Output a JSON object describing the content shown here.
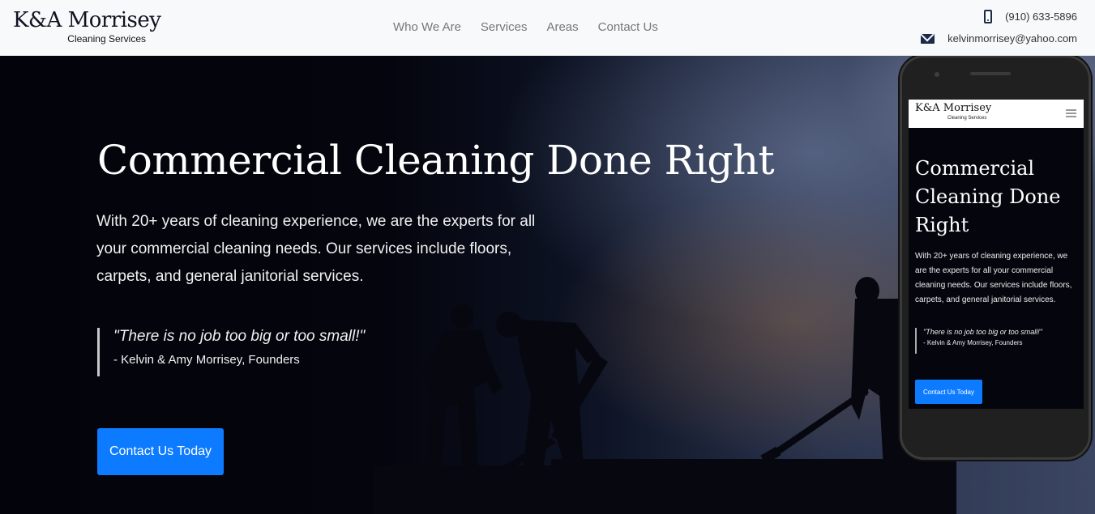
{
  "header": {
    "logo_main": "K&A Morrisey",
    "logo_sub": "Cleaning Services",
    "nav": [
      "Who We Are",
      "Services",
      "Areas",
      "Contact Us"
    ],
    "phone": "(910) 633-5896",
    "email": "kelvinmorrisey@yahoo.com",
    "phone_icon": "phone-icon",
    "email_icon": "envelope-icon"
  },
  "hero": {
    "title": "Commercial Cleaning Done Right",
    "description": "With 20+ years of cleaning experience, we are the experts for all your commercial cleaning needs. Our services include floors, carpets, and general janitorial services.",
    "quote": "\"There is no job too big or too small!\"",
    "quote_author": "- Kelvin & Amy Morrisey, Founders",
    "cta_label": "Contact Us Today"
  },
  "mobile_preview": {
    "logo_main": "K&A Morrisey",
    "logo_sub": "Cleaning Services",
    "menu_icon": "hamburger-menu-icon",
    "title": "Commercial Cleaning Done Right",
    "description": "With 20+ years of cleaning experience, we are the experts for all your commercial cleaning needs. Our services include floors, carpets, and general janitorial services.",
    "quote": "\"There is no job too big or too small!\"",
    "quote_author": "- Kelvin & Amy Morrisey, Founders",
    "cta_label": "Contact Us Today"
  },
  "colors": {
    "accent": "#0d7bff",
    "header_bg": "#f8f9fa",
    "hero_bg": "#05060d"
  }
}
